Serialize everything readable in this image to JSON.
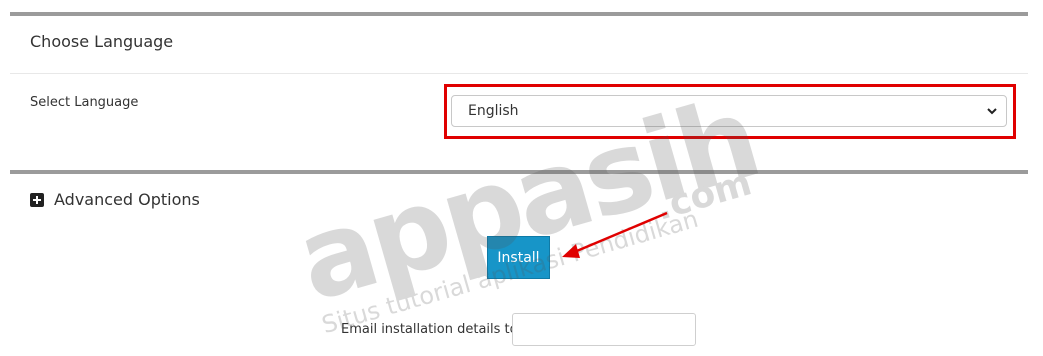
{
  "language_section": {
    "title": "Choose Language",
    "select_label": "Select Language",
    "selected_language": "English"
  },
  "advanced": {
    "label": "Advanced Options",
    "icon": "plus-square-icon"
  },
  "install": {
    "button_label": "Install"
  },
  "email": {
    "label": "Email installation details to :",
    "value": ""
  },
  "watermark": {
    "brand": "appasih",
    "domain": ".com",
    "tagline": "Situs tutorial aplikasi Pendidikan"
  },
  "colors": {
    "highlight": "#e00000",
    "button": "#1795c8",
    "arrow": "#e00000"
  }
}
